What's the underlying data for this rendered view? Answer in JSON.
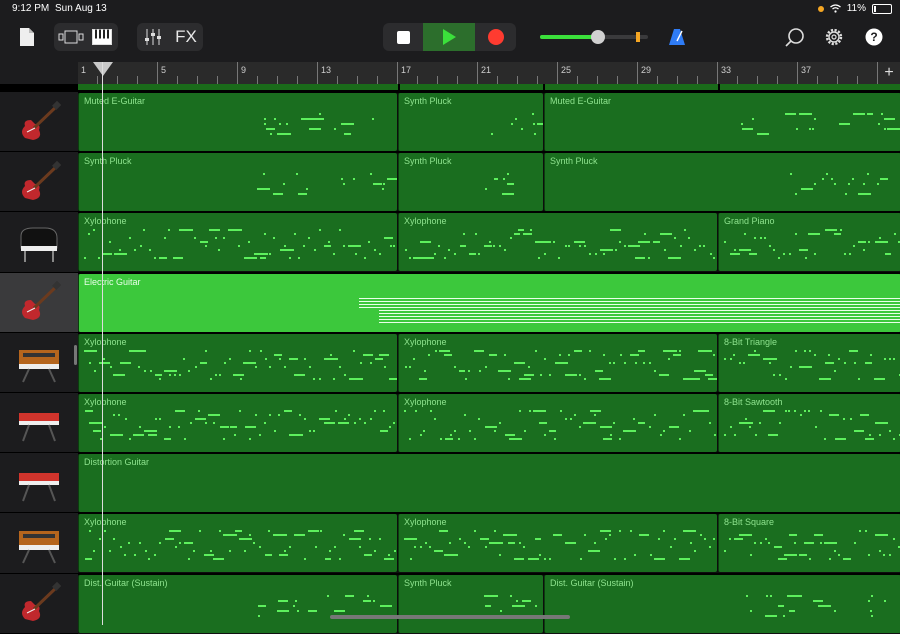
{
  "status": {
    "time": "9:12 PM",
    "date": "Sun Aug 13",
    "battery": "11%"
  },
  "toolbar": {
    "fx_label": "FX"
  },
  "icons": {
    "song": "document-icon",
    "tracks": "tracks-view-icon",
    "keyboard": "keyboard-icon",
    "mixer": "mixer-icon",
    "stop": "stop-icon",
    "play": "play-icon",
    "record": "record-icon",
    "metronome": "metronome-icon",
    "loop": "loop-icon",
    "settings": "gear-icon",
    "help": "help-icon"
  },
  "ruler": {
    "bars": [
      "1",
      "5",
      "9",
      "13",
      "17",
      "21",
      "25",
      "29",
      "33",
      "37"
    ],
    "add": "+"
  },
  "tracks": [
    {
      "instrument": "red-electric-guitar-icon",
      "selected": false,
      "regions": [
        "Muted E-Guitar",
        "Synth Pluck",
        "Muted E-Guitar"
      ]
    },
    {
      "instrument": "red-electric-guitar-icon",
      "selected": false,
      "regions": [
        "Synth Pluck",
        "Synth Pluck",
        "Synth Pluck"
      ]
    },
    {
      "instrument": "grand-piano-icon",
      "selected": false,
      "regions": [
        "Xylophone",
        "Xylophone",
        "Grand Piano"
      ]
    },
    {
      "instrument": "red-electric-guitar-icon",
      "selected": true,
      "regions": [
        "Electric Guitar"
      ]
    },
    {
      "instrument": "synth-keyboard-icon",
      "selected": false,
      "regions": [
        "Xylophone",
        "Xylophone",
        "8-Bit Triangle"
      ]
    },
    {
      "instrument": "red-keyboard-icon",
      "selected": false,
      "regions": [
        "Xylophone",
        "Xylophone",
        "8-Bit Sawtooth"
      ]
    },
    {
      "instrument": "red-keyboard-icon",
      "selected": false,
      "regions": [
        "Distortion Guitar"
      ]
    },
    {
      "instrument": "synth-keyboard-icon",
      "selected": false,
      "regions": [
        "Xylophone",
        "Xylophone",
        "8-Bit Square"
      ]
    },
    {
      "instrument": "red-electric-guitar-icon",
      "selected": false,
      "regions": [
        "Dist. Guitar (Sustain)",
        "Synth Pluck",
        "Dist. Guitar (Sustain)"
      ]
    }
  ],
  "colors": {
    "region": "#1a6e1f",
    "region_selected": "#3cc83c",
    "note": "#5df05d",
    "play": "#3be03b",
    "record": "#ff3b30"
  },
  "master_volume": 0.54
}
